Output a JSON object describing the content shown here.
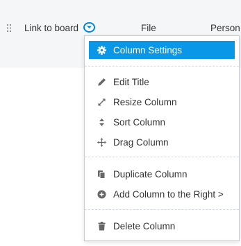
{
  "header": {
    "columns": [
      {
        "label": "Link to board"
      },
      {
        "label": "File"
      },
      {
        "label": "Person"
      }
    ]
  },
  "menu": {
    "items": [
      {
        "label": "Column Settings",
        "icon": "gear-icon",
        "active": true
      },
      {
        "label": "Edit Title",
        "icon": "pencil-icon"
      },
      {
        "label": "Resize Column",
        "icon": "resize-arrows-icon"
      },
      {
        "label": "Sort Column",
        "icon": "sort-icon"
      },
      {
        "label": "Drag Column",
        "icon": "move-icon"
      },
      {
        "label": "Duplicate Column",
        "icon": "duplicate-icon"
      },
      {
        "label": "Add Column to the Right >",
        "icon": "plus-circle-icon"
      },
      {
        "label": "Delete Column",
        "icon": "trash-icon"
      }
    ]
  },
  "colors": {
    "accent": "#0a97e8",
    "header_bg": "#f5f6f8",
    "text": "#333333"
  }
}
